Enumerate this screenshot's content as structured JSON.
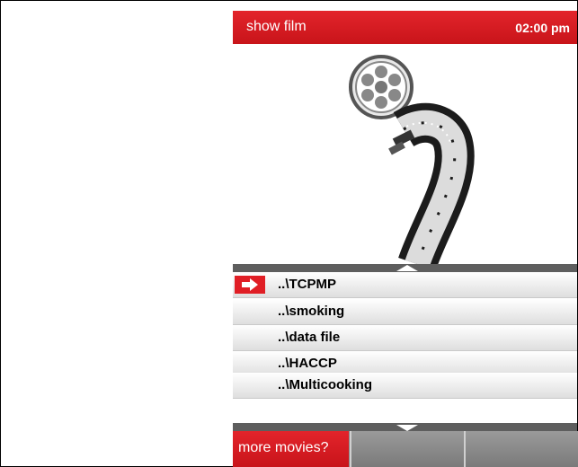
{
  "header": {
    "title": "show film",
    "time": "02:00 pm"
  },
  "files": [
    {
      "label": "..\\TCPMP",
      "selected": true
    },
    {
      "label": "..\\smoking",
      "selected": false
    },
    {
      "label": "..\\data file",
      "selected": false
    },
    {
      "label": "..\\HACCP",
      "selected": false
    },
    {
      "label": "..\\Multicooking",
      "selected": false
    }
  ],
  "footer": {
    "primary_label": "more movies?"
  },
  "colors": {
    "accent": "#d31a20",
    "separator": "#5e5e5e",
    "footer": "#8a8a8a"
  },
  "icons": {
    "selection": "right-arrow-icon",
    "scroll_up": "triangle-up-icon",
    "scroll_down": "triangle-down-icon",
    "artwork": "film-reel-icon"
  }
}
